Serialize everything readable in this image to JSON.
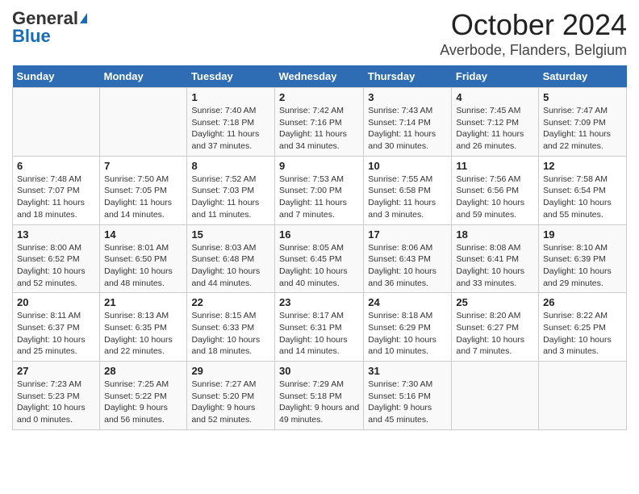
{
  "logo": {
    "general": "General",
    "blue": "Blue"
  },
  "title": "October 2024",
  "subtitle": "Averbode, Flanders, Belgium",
  "weekdays": [
    "Sunday",
    "Monday",
    "Tuesday",
    "Wednesday",
    "Thursday",
    "Friday",
    "Saturday"
  ],
  "weeks": [
    [
      {
        "day": "",
        "info": ""
      },
      {
        "day": "",
        "info": ""
      },
      {
        "day": "1",
        "info": "Sunrise: 7:40 AM\nSunset: 7:18 PM\nDaylight: 11 hours and 37 minutes."
      },
      {
        "day": "2",
        "info": "Sunrise: 7:42 AM\nSunset: 7:16 PM\nDaylight: 11 hours and 34 minutes."
      },
      {
        "day": "3",
        "info": "Sunrise: 7:43 AM\nSunset: 7:14 PM\nDaylight: 11 hours and 30 minutes."
      },
      {
        "day": "4",
        "info": "Sunrise: 7:45 AM\nSunset: 7:12 PM\nDaylight: 11 hours and 26 minutes."
      },
      {
        "day": "5",
        "info": "Sunrise: 7:47 AM\nSunset: 7:09 PM\nDaylight: 11 hours and 22 minutes."
      }
    ],
    [
      {
        "day": "6",
        "info": "Sunrise: 7:48 AM\nSunset: 7:07 PM\nDaylight: 11 hours and 18 minutes."
      },
      {
        "day": "7",
        "info": "Sunrise: 7:50 AM\nSunset: 7:05 PM\nDaylight: 11 hours and 14 minutes."
      },
      {
        "day": "8",
        "info": "Sunrise: 7:52 AM\nSunset: 7:03 PM\nDaylight: 11 hours and 11 minutes."
      },
      {
        "day": "9",
        "info": "Sunrise: 7:53 AM\nSunset: 7:00 PM\nDaylight: 11 hours and 7 minutes."
      },
      {
        "day": "10",
        "info": "Sunrise: 7:55 AM\nSunset: 6:58 PM\nDaylight: 11 hours and 3 minutes."
      },
      {
        "day": "11",
        "info": "Sunrise: 7:56 AM\nSunset: 6:56 PM\nDaylight: 10 hours and 59 minutes."
      },
      {
        "day": "12",
        "info": "Sunrise: 7:58 AM\nSunset: 6:54 PM\nDaylight: 10 hours and 55 minutes."
      }
    ],
    [
      {
        "day": "13",
        "info": "Sunrise: 8:00 AM\nSunset: 6:52 PM\nDaylight: 10 hours and 52 minutes."
      },
      {
        "day": "14",
        "info": "Sunrise: 8:01 AM\nSunset: 6:50 PM\nDaylight: 10 hours and 48 minutes."
      },
      {
        "day": "15",
        "info": "Sunrise: 8:03 AM\nSunset: 6:48 PM\nDaylight: 10 hours and 44 minutes."
      },
      {
        "day": "16",
        "info": "Sunrise: 8:05 AM\nSunset: 6:45 PM\nDaylight: 10 hours and 40 minutes."
      },
      {
        "day": "17",
        "info": "Sunrise: 8:06 AM\nSunset: 6:43 PM\nDaylight: 10 hours and 36 minutes."
      },
      {
        "day": "18",
        "info": "Sunrise: 8:08 AM\nSunset: 6:41 PM\nDaylight: 10 hours and 33 minutes."
      },
      {
        "day": "19",
        "info": "Sunrise: 8:10 AM\nSunset: 6:39 PM\nDaylight: 10 hours and 29 minutes."
      }
    ],
    [
      {
        "day": "20",
        "info": "Sunrise: 8:11 AM\nSunset: 6:37 PM\nDaylight: 10 hours and 25 minutes."
      },
      {
        "day": "21",
        "info": "Sunrise: 8:13 AM\nSunset: 6:35 PM\nDaylight: 10 hours and 22 minutes."
      },
      {
        "day": "22",
        "info": "Sunrise: 8:15 AM\nSunset: 6:33 PM\nDaylight: 10 hours and 18 minutes."
      },
      {
        "day": "23",
        "info": "Sunrise: 8:17 AM\nSunset: 6:31 PM\nDaylight: 10 hours and 14 minutes."
      },
      {
        "day": "24",
        "info": "Sunrise: 8:18 AM\nSunset: 6:29 PM\nDaylight: 10 hours and 10 minutes."
      },
      {
        "day": "25",
        "info": "Sunrise: 8:20 AM\nSunset: 6:27 PM\nDaylight: 10 hours and 7 minutes."
      },
      {
        "day": "26",
        "info": "Sunrise: 8:22 AM\nSunset: 6:25 PM\nDaylight: 10 hours and 3 minutes."
      }
    ],
    [
      {
        "day": "27",
        "info": "Sunrise: 7:23 AM\nSunset: 5:23 PM\nDaylight: 10 hours and 0 minutes."
      },
      {
        "day": "28",
        "info": "Sunrise: 7:25 AM\nSunset: 5:22 PM\nDaylight: 9 hours and 56 minutes."
      },
      {
        "day": "29",
        "info": "Sunrise: 7:27 AM\nSunset: 5:20 PM\nDaylight: 9 hours and 52 minutes."
      },
      {
        "day": "30",
        "info": "Sunrise: 7:29 AM\nSunset: 5:18 PM\nDaylight: 9 hours and 49 minutes."
      },
      {
        "day": "31",
        "info": "Sunrise: 7:30 AM\nSunset: 5:16 PM\nDaylight: 9 hours and 45 minutes."
      },
      {
        "day": "",
        "info": ""
      },
      {
        "day": "",
        "info": ""
      }
    ]
  ]
}
